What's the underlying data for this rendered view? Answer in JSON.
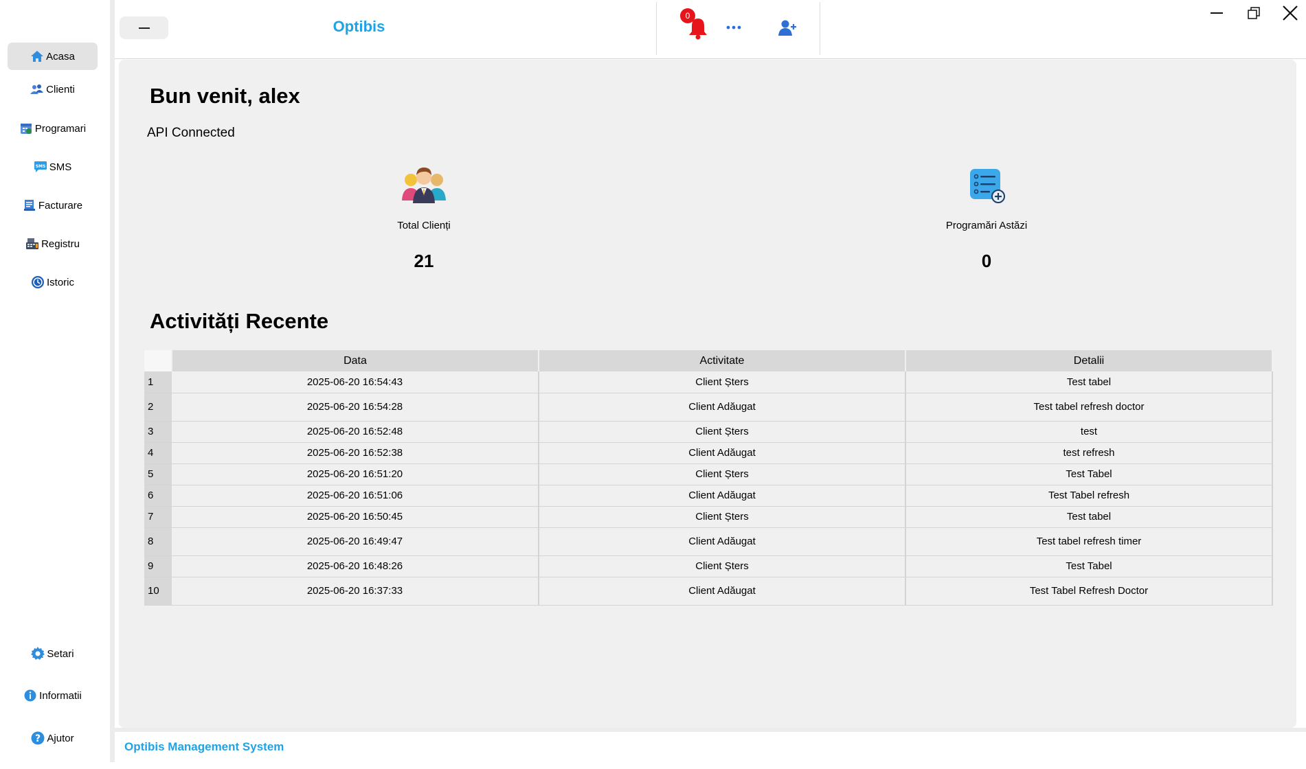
{
  "app": {
    "title": "Optibis",
    "footer": "Optibis Management System"
  },
  "sidebar": {
    "items": [
      {
        "label": "Acasa",
        "icon": "home-icon"
      },
      {
        "label": "Clienti",
        "icon": "users-icon"
      },
      {
        "label": "Programari",
        "icon": "calendar-icon"
      },
      {
        "label": "SMS",
        "icon": "sms-icon"
      },
      {
        "label": "Facturare",
        "icon": "invoice-icon"
      },
      {
        "label": "Registru",
        "icon": "cash-register-icon"
      },
      {
        "label": "Istoric",
        "icon": "history-icon"
      }
    ],
    "bottom": [
      {
        "label": "Setari",
        "icon": "gear-icon"
      },
      {
        "label": "Informatii",
        "icon": "info-icon"
      },
      {
        "label": "Ajutor",
        "icon": "help-icon"
      }
    ]
  },
  "topbar": {
    "notification_count": "0"
  },
  "dashboard": {
    "welcome": "Bun venit, alex",
    "api_status": "API Connected",
    "stats": [
      {
        "label": "Total Clienți",
        "value": "21",
        "icon": "clients-group-icon"
      },
      {
        "label": "Programări Astăzi",
        "value": "0",
        "icon": "appointment-list-icon"
      }
    ],
    "recent_title": "Activități Recente"
  },
  "table": {
    "columns": [
      "Data",
      "Activitate",
      "Detalii"
    ],
    "rows": [
      [
        "1",
        "2025-06-20 16:54:43",
        "Client Șters",
        "Test tabel"
      ],
      [
        "2",
        "2025-06-20 16:54:28",
        "Client Adăugat",
        "Test tabel refresh doctor"
      ],
      [
        "3",
        "2025-06-20 16:52:48",
        "Client Șters",
        "test"
      ],
      [
        "4",
        "2025-06-20 16:52:38",
        "Client Adăugat",
        "test refresh"
      ],
      [
        "5",
        "2025-06-20 16:51:20",
        "Client Șters",
        "Test Tabel"
      ],
      [
        "6",
        "2025-06-20 16:51:06",
        "Client Adăugat",
        "Test Tabel refresh"
      ],
      [
        "7",
        "2025-06-20 16:50:45",
        "Client Șters",
        "Test tabel"
      ],
      [
        "8",
        "2025-06-20 16:49:47",
        "Client Adăugat",
        "Test tabel refresh timer"
      ],
      [
        "9",
        "2025-06-20 16:48:26",
        "Client Șters",
        "Test Tabel"
      ],
      [
        "10",
        "2025-06-20 16:37:33",
        "Client Adăugat",
        "Test Tabel Refresh Doctor"
      ]
    ]
  },
  "colors": {
    "accent": "#1fa3e6",
    "badge": "#e8141b",
    "panel": "#f0f0f0",
    "header_cell": "#d8d8d8"
  }
}
